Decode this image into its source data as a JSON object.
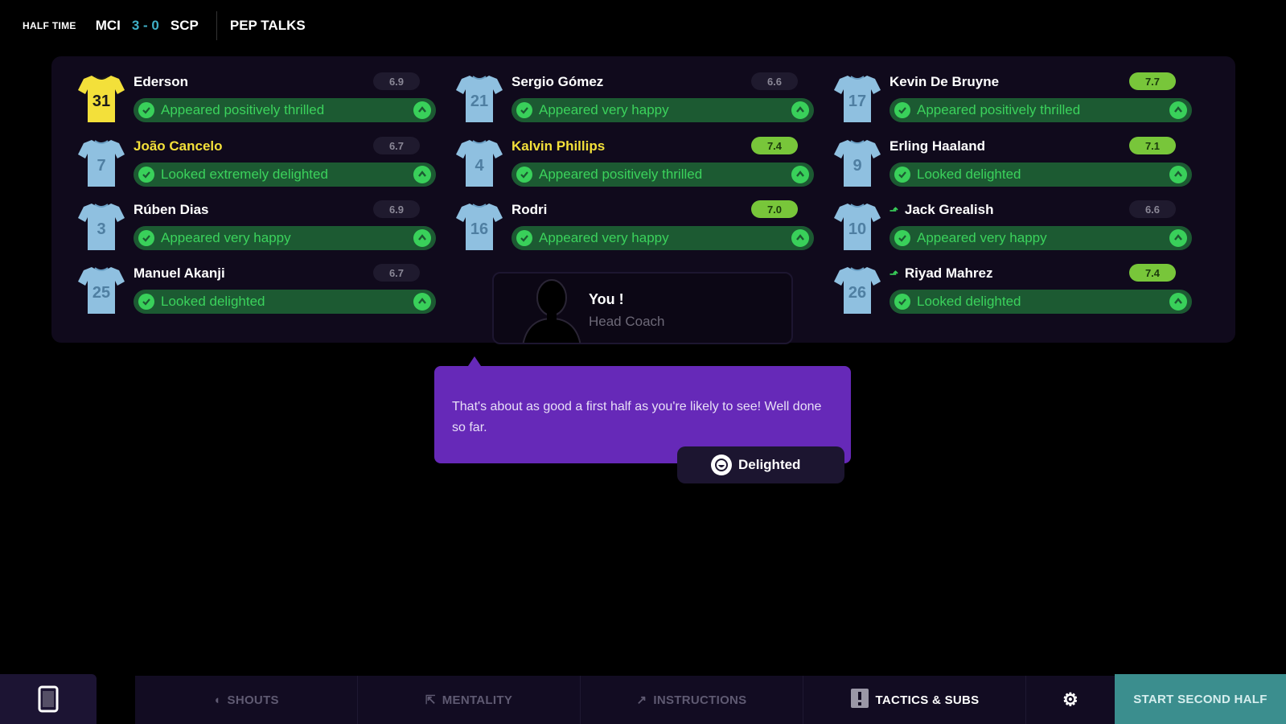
{
  "header": {
    "phase": "HALF TIME",
    "home": "MCI",
    "score": "3 - 0",
    "away": "SCP",
    "title": "PEP TALKS"
  },
  "players": [
    {
      "number": "31",
      "name": "Ederson",
      "name_color": "white",
      "rating": "6.9",
      "rating_good": false,
      "reaction": "Appeared positively thrilled",
      "shirt": "keeper",
      "sub": false
    },
    {
      "number": "7",
      "name": "João Cancelo",
      "name_color": "yellow",
      "rating": "6.7",
      "rating_good": false,
      "reaction": "Looked extremely delighted",
      "shirt": "outfield",
      "sub": false
    },
    {
      "number": "3",
      "name": "Rúben Dias",
      "name_color": "white",
      "rating": "6.9",
      "rating_good": false,
      "reaction": "Appeared very happy",
      "shirt": "outfield",
      "sub": false
    },
    {
      "number": "25",
      "name": "Manuel Akanji",
      "name_color": "white",
      "rating": "6.7",
      "rating_good": false,
      "reaction": "Looked delighted",
      "shirt": "outfield",
      "sub": false
    },
    {
      "number": "21",
      "name": "Sergio Gómez",
      "name_color": "white",
      "rating": "6.6",
      "rating_good": false,
      "reaction": "Appeared very happy",
      "shirt": "outfield",
      "sub": false
    },
    {
      "number": "4",
      "name": "Kalvin Phillips",
      "name_color": "yellow",
      "rating": "7.4",
      "rating_good": true,
      "reaction": "Appeared positively thrilled",
      "shirt": "outfield",
      "sub": false
    },
    {
      "number": "16",
      "name": "Rodri",
      "name_color": "white",
      "rating": "7.0",
      "rating_good": true,
      "reaction": "Appeared very happy",
      "shirt": "outfield",
      "sub": false
    },
    {
      "number": "17",
      "name": "Kevin De Bruyne",
      "name_color": "white",
      "rating": "7.7",
      "rating_good": true,
      "reaction": "Appeared positively thrilled",
      "shirt": "outfield",
      "sub": false
    },
    {
      "number": "9",
      "name": "Erling Haaland",
      "name_color": "white",
      "rating": "7.1",
      "rating_good": true,
      "reaction": "Looked delighted",
      "shirt": "outfield",
      "sub": false
    },
    {
      "number": "10",
      "name": "Jack Grealish",
      "name_color": "white",
      "rating": "6.6",
      "rating_good": false,
      "reaction": "Appeared very happy",
      "shirt": "outfield",
      "sub": true
    },
    {
      "number": "26",
      "name": "Riyad Mahrez",
      "name_color": "white",
      "rating": "7.4",
      "rating_good": true,
      "reaction": "Looked delighted",
      "shirt": "outfield",
      "sub": true
    }
  ],
  "coach": {
    "name": "You !",
    "role": "Head Coach"
  },
  "talk": {
    "text": "That's about as good a first half as you're likely to see! Well done so far.",
    "reaction": "Delighted"
  },
  "bottom": {
    "shouts": "SHOUTS",
    "mentality": "MENTALITY",
    "instructions": "INSTRUCTIONS",
    "tactics": "TACTICS & SUBS",
    "start": "START SECOND HALF"
  },
  "colors": {
    "panel": "#100a1c",
    "reaction_bg": "#1c5a32",
    "reaction_text": "#3bd25c",
    "good_rating": "#78c63a",
    "bubble": "#6629b8",
    "start_button": "#3b8e8e",
    "shirt_outfield": "#8fc0e0",
    "shirt_keeper": "#f3e03a"
  }
}
